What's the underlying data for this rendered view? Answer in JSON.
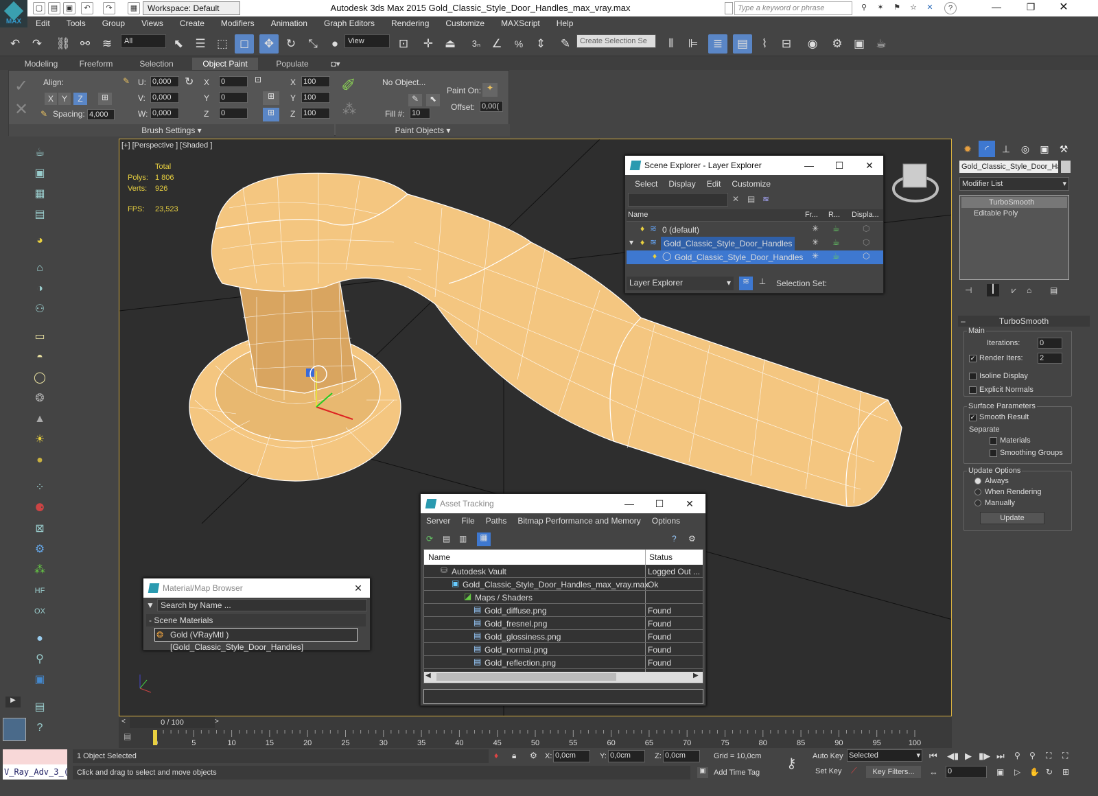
{
  "app": {
    "title": "Autodesk 3ds Max  2015    Gold_Classic_Style_Door_Handles_max_vray.max",
    "logo_text": "MAX",
    "workspace": "Workspace: Default",
    "search_placeholder": "Type a keyword or phrase"
  },
  "menu": [
    "Edit",
    "Tools",
    "Group",
    "Views",
    "Create",
    "Modifiers",
    "Animation",
    "Graph Editors",
    "Rendering",
    "Customize",
    "MAXScript",
    "Help"
  ],
  "toolbar": {
    "filter": "All",
    "ref_coord": "View",
    "selection_set": "Create Selection Se",
    "snap_3": "3"
  },
  "ribbon": {
    "tabs": [
      "Modeling",
      "Freeform",
      "Selection",
      "Object Paint",
      "Populate"
    ],
    "active_tab": "Object Paint",
    "align_label": "Align:",
    "x": "X",
    "y": "Y",
    "z": "Z",
    "spacing_label": "Spacing:",
    "spacing": "4,000",
    "u_label": "U:",
    "v_label": "V:",
    "w_label": "W:",
    "u": "0,000",
    "v": "0,000",
    "w": "0,000",
    "rx": "0",
    "ry": "0",
    "rz": "0",
    "sx": "100",
    "sy": "100",
    "sz": "100",
    "no_object": "No Object...",
    "fill_label": "Fill #:",
    "fill": "10",
    "paint_on": "Paint On:",
    "offset_label": "Offset:",
    "offset": "0,00(",
    "brush_settings": "Brush Settings",
    "paint_objects": "Paint Objects"
  },
  "viewport": {
    "label": "[+] [Perspective ] [Shaded ]",
    "total": "Total",
    "polys_label": "Polys:",
    "polys": "1 806",
    "verts_label": "Verts:",
    "verts": "926",
    "fps_label": "FPS:",
    "fps": "23,523"
  },
  "scene_explorer": {
    "title": "Scene Explorer - Layer Explorer",
    "menu": [
      "Select",
      "Display",
      "Edit",
      "Customize"
    ],
    "cols": [
      "Name",
      "Fr...",
      "R...",
      "Displa..."
    ],
    "rows": [
      {
        "name": "0 (default)"
      },
      {
        "name": "Gold_Classic_Style_Door_Handles"
      },
      {
        "name": "Gold_Classic_Style_Door_Handles"
      }
    ],
    "mode": "Layer Explorer",
    "selection_set": "Selection Set:"
  },
  "material_browser": {
    "title": "Material/Map Browser",
    "search": "Search by Name ...",
    "group": "- Scene Materials",
    "item": "Gold (VRayMtl ) [Gold_Classic_Style_Door_Handles]"
  },
  "asset_tracking": {
    "title": "Asset Tracking",
    "menu": [
      "Server",
      "File",
      "Paths",
      "Bitmap Performance and Memory",
      "Options"
    ],
    "cols": [
      "Name",
      "Status"
    ],
    "rows": [
      {
        "name": "Autodesk Vault",
        "status": "Logged Out ..."
      },
      {
        "name": "Gold_Classic_Style_Door_Handles_max_vray.max",
        "status": "Ok"
      },
      {
        "name": "Maps / Shaders",
        "status": ""
      },
      {
        "name": "Gold_diffuse.png",
        "status": "Found"
      },
      {
        "name": "Gold_fresnel.png",
        "status": "Found"
      },
      {
        "name": "Gold_glossiness.png",
        "status": "Found"
      },
      {
        "name": "Gold_normal.png",
        "status": "Found"
      },
      {
        "name": "Gold_reflection.png",
        "status": "Found"
      }
    ]
  },
  "command_panel": {
    "object_name": "Gold_Classic_Style_Door_Har",
    "modifier_list": "Modifier List",
    "stack": [
      "TurboSmooth",
      "Editable Poly"
    ],
    "rollout": "TurboSmooth",
    "main": "Main",
    "iterations_label": "Iterations:",
    "iterations": "0",
    "render_iters_label": "Render Iters:",
    "render_iters": "2",
    "isoline": "Isoline Display",
    "explicit": "Explicit Normals",
    "surface": "Surface Parameters",
    "smooth_result": "Smooth Result",
    "separate": "Separate",
    "materials": "Materials",
    "smoothing_groups": "Smoothing Groups",
    "update_options": "Update Options",
    "always": "Always",
    "when_rendering": "When Rendering",
    "manually": "Manually",
    "update": "Update"
  },
  "timeline": {
    "frame": "0 / 100",
    "ticks": [
      "0",
      "5",
      "10",
      "15",
      "20",
      "25",
      "30",
      "35",
      "40",
      "45",
      "50",
      "55",
      "60",
      "65",
      "70",
      "75",
      "80",
      "85",
      "90",
      "95",
      "100"
    ]
  },
  "status": {
    "maxscript": "V_Ray_Adv_3_(",
    "selected": "1 Object Selected",
    "prompt": "Click and drag to select and move objects",
    "x_label": "X:",
    "y_label": "Y:",
    "z_label": "Z:",
    "x": "0,0cm",
    "y": "0,0cm",
    "z": "0,0cm",
    "grid": "Grid = 10,0cm",
    "auto_key": "Auto Key",
    "set_key": "Set Key",
    "key_mode": "Selected",
    "key_filters": "Key Filters...",
    "add_time_tag": "Add Time Tag",
    "frame": "0"
  }
}
